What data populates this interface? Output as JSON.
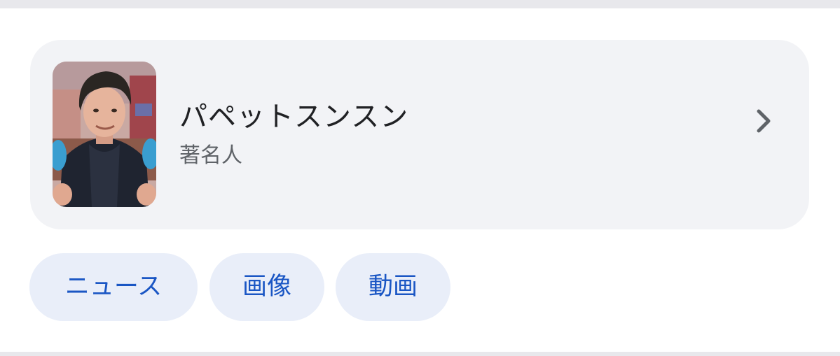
{
  "entity": {
    "name": "パペットスンスン",
    "type": "著名人",
    "thumbnail_icon": "person-photo-thumbnail",
    "chevron_icon": "chevron-right-icon"
  },
  "chips": [
    {
      "label": "ニュース"
    },
    {
      "label": "画像"
    },
    {
      "label": "動画"
    }
  ],
  "colors": {
    "card_bg": "#f2f3f6",
    "chip_bg": "#e9eef9",
    "chip_text": "#1a56c4",
    "title_text": "#202124",
    "subtitle_text": "#5f6368",
    "divider": "#e8e8ec"
  }
}
